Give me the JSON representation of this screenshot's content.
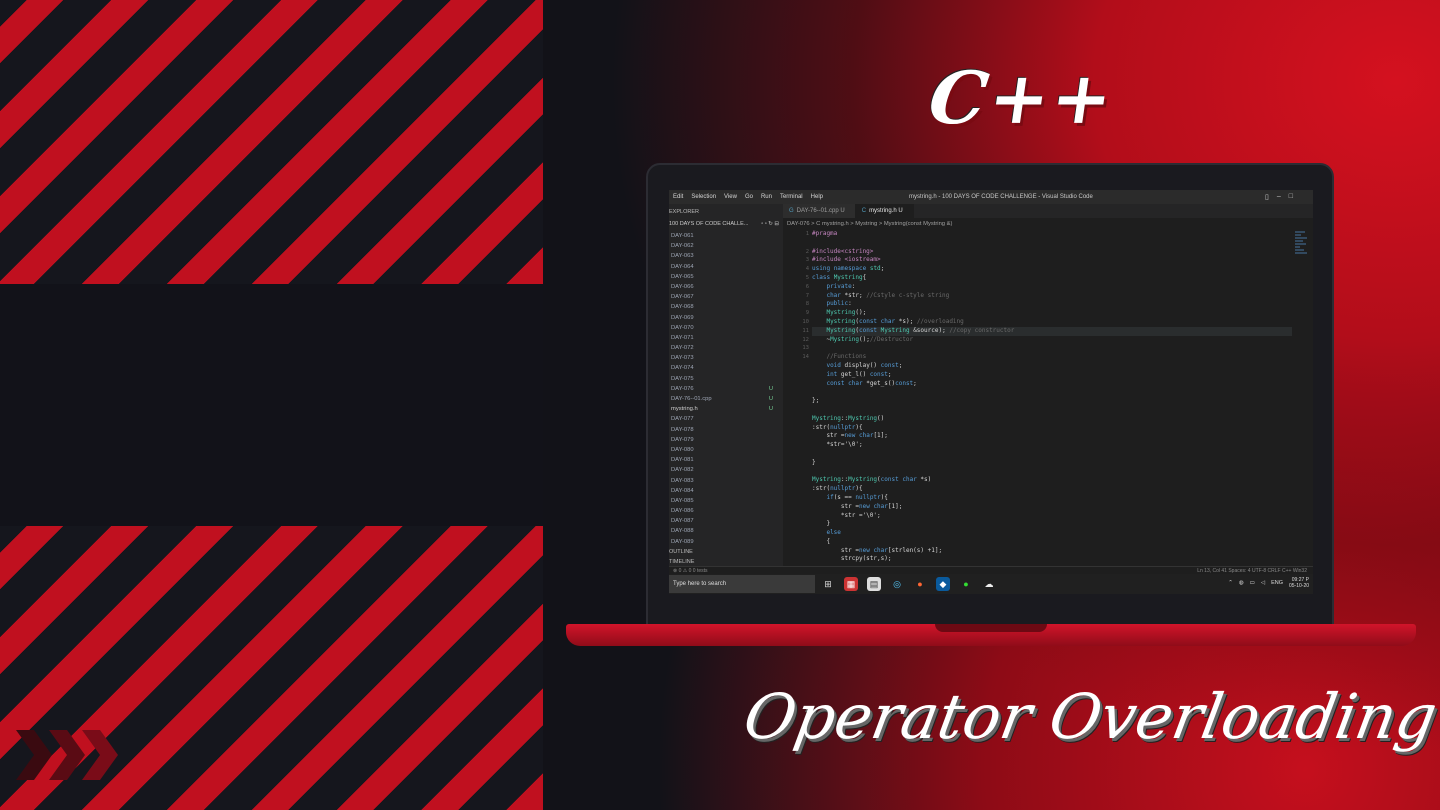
{
  "titles": {
    "cpp": "C++",
    "topic": "Operator Overloading"
  },
  "window": {
    "title": "mystring.h - 100 DAYS OF CODE CHALLENGE - Visual Studio Code",
    "menu": [
      "Edit",
      "Selection",
      "View",
      "Go",
      "Run",
      "Terminal",
      "Help"
    ]
  },
  "sidebar": {
    "header": "EXPLORER",
    "project": "100 DAYS OF CODE CHALLE...",
    "items": [
      {
        "label": "DAY-061",
        "badge": ""
      },
      {
        "label": "DAY-062",
        "badge": ""
      },
      {
        "label": "DAY-063",
        "badge": ""
      },
      {
        "label": "DAY-064",
        "badge": ""
      },
      {
        "label": "DAY-065",
        "badge": ""
      },
      {
        "label": "DAY-066",
        "badge": ""
      },
      {
        "label": "DAY-067",
        "badge": ""
      },
      {
        "label": "DAY-068",
        "badge": ""
      },
      {
        "label": "DAY-069",
        "badge": ""
      },
      {
        "label": "DAY-070",
        "badge": ""
      },
      {
        "label": "DAY-071",
        "badge": ""
      },
      {
        "label": "DAY-072",
        "badge": ""
      },
      {
        "label": "DAY-073",
        "badge": ""
      },
      {
        "label": "DAY-074",
        "badge": ""
      },
      {
        "label": "DAY-075",
        "badge": ""
      },
      {
        "label": "DAY-076",
        "badge": "U"
      },
      {
        "label": "DAY-76--01.cpp",
        "badge": "U"
      },
      {
        "label": "mystring.h",
        "badge": "U"
      },
      {
        "label": "DAY-077",
        "badge": ""
      },
      {
        "label": "DAY-078",
        "badge": ""
      },
      {
        "label": "DAY-079",
        "badge": ""
      },
      {
        "label": "DAY-080",
        "badge": ""
      },
      {
        "label": "DAY-081",
        "badge": ""
      },
      {
        "label": "DAY-082",
        "badge": ""
      },
      {
        "label": "DAY-083",
        "badge": ""
      },
      {
        "label": "DAY-084",
        "badge": ""
      },
      {
        "label": "DAY-085",
        "badge": ""
      },
      {
        "label": "DAY-086",
        "badge": ""
      },
      {
        "label": "DAY-087",
        "badge": ""
      },
      {
        "label": "DAY-088",
        "badge": ""
      },
      {
        "label": "DAY-089",
        "badge": ""
      }
    ],
    "outline": "OUTLINE",
    "timeline": "TIMELINE"
  },
  "tabs": [
    {
      "label": "DAY-76--01.cpp",
      "flag": "U"
    },
    {
      "label": "mystring.h",
      "flag": "U"
    }
  ],
  "breadcrumb": "DAY-076 > C mystring.h > Mystring > Mystring(const Mystring &)",
  "editor": {
    "line_numbers": [
      "1",
      "",
      "2",
      "3",
      "4",
      "5",
      "6",
      "7",
      "8",
      "9",
      "10",
      "11",
      "12",
      "13",
      "14",
      "",
      "",
      "",
      "",
      "",
      "",
      "",
      "",
      "",
      "",
      "",
      "",
      "",
      "",
      "",
      "",
      "",
      "",
      "",
      "",
      "",
      "",
      "",
      ""
    ],
    "lines": [
      "#pragma",
      "",
      "#include<cstring>",
      "#include <iostream>",
      "using namespace std;",
      "class Mystring{",
      "    private:",
      "    char *str; //Cstyle c-style string",
      "    public:",
      "    Mystring();",
      "    Mystring(const char *s); //overloading",
      "    Mystring(const Mystring &source); //copy constructor",
      "    ~Mystring();//Destructor",
      "",
      "    //Functions",
      "    void display() const;",
      "    int get_l() const;",
      "    const char *get_s()const;",
      "",
      "};",
      "",
      "Mystring::Mystring()",
      ":str(nullptr){",
      "    str =new char[1];",
      "    *str='\\0';",
      "",
      "}",
      "",
      "Mystring::Mystring(const char *s)",
      ":str(nullptr){",
      "    if(s == nullptr){",
      "        str =new char[1];",
      "        *str ='\\0';",
      "    }",
      "    else",
      "    {",
      "        str =new char[strlen(s) +1];",
      "        strcpy(str,s);"
    ],
    "highlighted_line": 11
  },
  "status": {
    "left": "⊗ 0  ⚠ 0     0 tests",
    "right": "Ln 13, Col 41   Spaces: 4   UTF-8   CRLF   C++   Win32"
  },
  "taskbar": {
    "search_placeholder": "Type here to search",
    "lang": "ENG",
    "time": "09:27 P",
    "date": "05-10-20"
  }
}
